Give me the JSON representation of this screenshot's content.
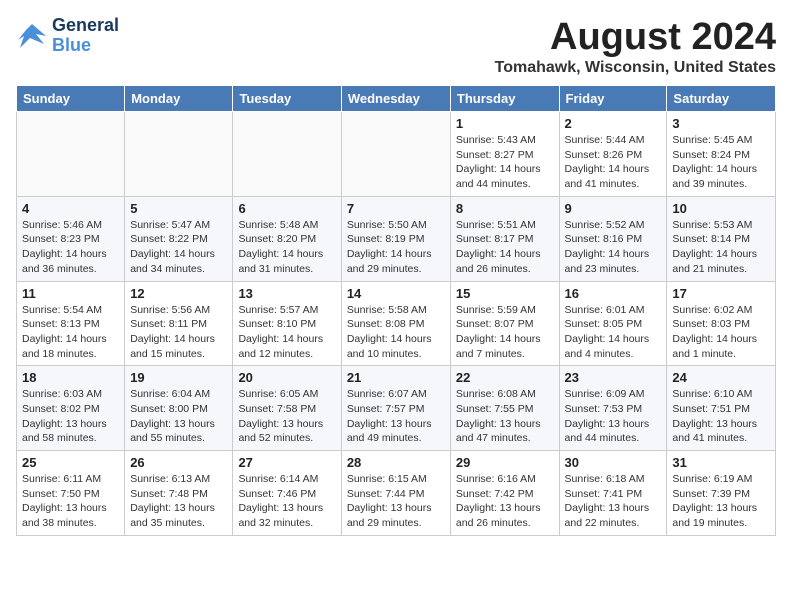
{
  "logo": {
    "line1": "General",
    "line2": "Blue"
  },
  "title": {
    "month_year": "August 2024",
    "location": "Tomahawk, Wisconsin, United States"
  },
  "days_of_week": [
    "Sunday",
    "Monday",
    "Tuesday",
    "Wednesday",
    "Thursday",
    "Friday",
    "Saturday"
  ],
  "weeks": [
    [
      {
        "day": "",
        "info": ""
      },
      {
        "day": "",
        "info": ""
      },
      {
        "day": "",
        "info": ""
      },
      {
        "day": "",
        "info": ""
      },
      {
        "day": "1",
        "info": "Sunrise: 5:43 AM\nSunset: 8:27 PM\nDaylight: 14 hours\nand 44 minutes."
      },
      {
        "day": "2",
        "info": "Sunrise: 5:44 AM\nSunset: 8:26 PM\nDaylight: 14 hours\nand 41 minutes."
      },
      {
        "day": "3",
        "info": "Sunrise: 5:45 AM\nSunset: 8:24 PM\nDaylight: 14 hours\nand 39 minutes."
      }
    ],
    [
      {
        "day": "4",
        "info": "Sunrise: 5:46 AM\nSunset: 8:23 PM\nDaylight: 14 hours\nand 36 minutes."
      },
      {
        "day": "5",
        "info": "Sunrise: 5:47 AM\nSunset: 8:22 PM\nDaylight: 14 hours\nand 34 minutes."
      },
      {
        "day": "6",
        "info": "Sunrise: 5:48 AM\nSunset: 8:20 PM\nDaylight: 14 hours\nand 31 minutes."
      },
      {
        "day": "7",
        "info": "Sunrise: 5:50 AM\nSunset: 8:19 PM\nDaylight: 14 hours\nand 29 minutes."
      },
      {
        "day": "8",
        "info": "Sunrise: 5:51 AM\nSunset: 8:17 PM\nDaylight: 14 hours\nand 26 minutes."
      },
      {
        "day": "9",
        "info": "Sunrise: 5:52 AM\nSunset: 8:16 PM\nDaylight: 14 hours\nand 23 minutes."
      },
      {
        "day": "10",
        "info": "Sunrise: 5:53 AM\nSunset: 8:14 PM\nDaylight: 14 hours\nand 21 minutes."
      }
    ],
    [
      {
        "day": "11",
        "info": "Sunrise: 5:54 AM\nSunset: 8:13 PM\nDaylight: 14 hours\nand 18 minutes."
      },
      {
        "day": "12",
        "info": "Sunrise: 5:56 AM\nSunset: 8:11 PM\nDaylight: 14 hours\nand 15 minutes."
      },
      {
        "day": "13",
        "info": "Sunrise: 5:57 AM\nSunset: 8:10 PM\nDaylight: 14 hours\nand 12 minutes."
      },
      {
        "day": "14",
        "info": "Sunrise: 5:58 AM\nSunset: 8:08 PM\nDaylight: 14 hours\nand 10 minutes."
      },
      {
        "day": "15",
        "info": "Sunrise: 5:59 AM\nSunset: 8:07 PM\nDaylight: 14 hours\nand 7 minutes."
      },
      {
        "day": "16",
        "info": "Sunrise: 6:01 AM\nSunset: 8:05 PM\nDaylight: 14 hours\nand 4 minutes."
      },
      {
        "day": "17",
        "info": "Sunrise: 6:02 AM\nSunset: 8:03 PM\nDaylight: 14 hours\nand 1 minute."
      }
    ],
    [
      {
        "day": "18",
        "info": "Sunrise: 6:03 AM\nSunset: 8:02 PM\nDaylight: 13 hours\nand 58 minutes."
      },
      {
        "day": "19",
        "info": "Sunrise: 6:04 AM\nSunset: 8:00 PM\nDaylight: 13 hours\nand 55 minutes."
      },
      {
        "day": "20",
        "info": "Sunrise: 6:05 AM\nSunset: 7:58 PM\nDaylight: 13 hours\nand 52 minutes."
      },
      {
        "day": "21",
        "info": "Sunrise: 6:07 AM\nSunset: 7:57 PM\nDaylight: 13 hours\nand 49 minutes."
      },
      {
        "day": "22",
        "info": "Sunrise: 6:08 AM\nSunset: 7:55 PM\nDaylight: 13 hours\nand 47 minutes."
      },
      {
        "day": "23",
        "info": "Sunrise: 6:09 AM\nSunset: 7:53 PM\nDaylight: 13 hours\nand 44 minutes."
      },
      {
        "day": "24",
        "info": "Sunrise: 6:10 AM\nSunset: 7:51 PM\nDaylight: 13 hours\nand 41 minutes."
      }
    ],
    [
      {
        "day": "25",
        "info": "Sunrise: 6:11 AM\nSunset: 7:50 PM\nDaylight: 13 hours\nand 38 minutes."
      },
      {
        "day": "26",
        "info": "Sunrise: 6:13 AM\nSunset: 7:48 PM\nDaylight: 13 hours\nand 35 minutes."
      },
      {
        "day": "27",
        "info": "Sunrise: 6:14 AM\nSunset: 7:46 PM\nDaylight: 13 hours\nand 32 minutes."
      },
      {
        "day": "28",
        "info": "Sunrise: 6:15 AM\nSunset: 7:44 PM\nDaylight: 13 hours\nand 29 minutes."
      },
      {
        "day": "29",
        "info": "Sunrise: 6:16 AM\nSunset: 7:42 PM\nDaylight: 13 hours\nand 26 minutes."
      },
      {
        "day": "30",
        "info": "Sunrise: 6:18 AM\nSunset: 7:41 PM\nDaylight: 13 hours\nand 22 minutes."
      },
      {
        "day": "31",
        "info": "Sunrise: 6:19 AM\nSunset: 7:39 PM\nDaylight: 13 hours\nand 19 minutes."
      }
    ]
  ]
}
